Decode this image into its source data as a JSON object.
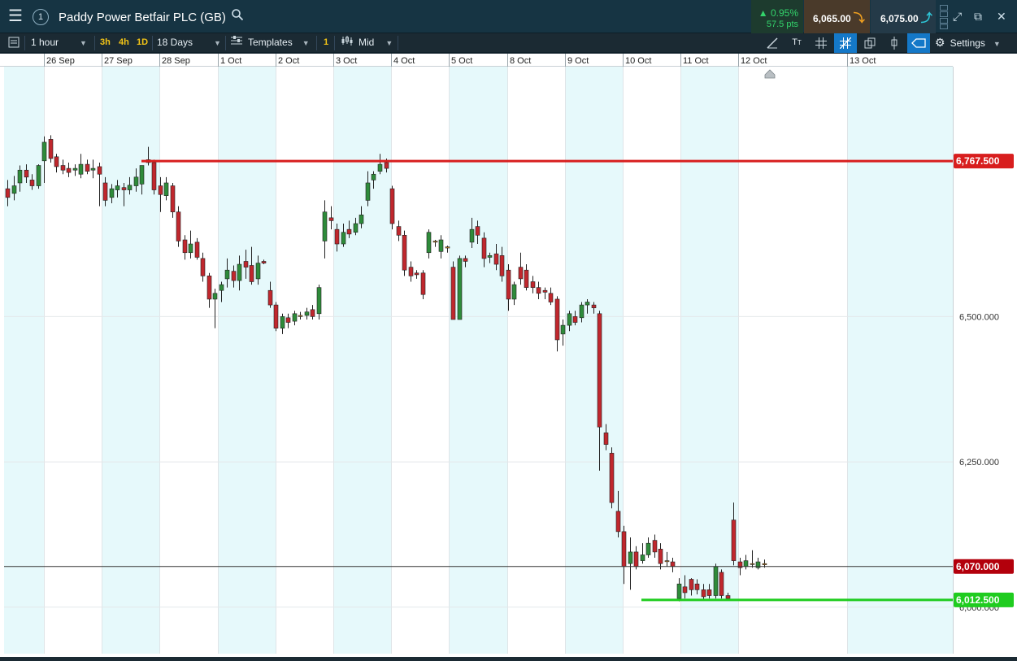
{
  "header": {
    "title": "Paddy Power Betfair PLC (GB)",
    "window_number": "1",
    "change_pct": "0.95%",
    "change_pts": "57.5 pts",
    "sell_price": "6,065.00",
    "buy_price": "6,075.00"
  },
  "toolbar": {
    "interval": "1 hour",
    "quick_intervals": [
      "3h",
      "4h",
      "1D"
    ],
    "range": "18 Days",
    "templates": "Templates",
    "templates_badge": "1",
    "price_type": "Mid",
    "settings": "Settings"
  },
  "colors": {
    "up": "#2e8b3a",
    "down": "#c0272d",
    "resistance": "#d81e1e",
    "support": "#1fcc1f",
    "current": "#b3000c",
    "band": "#e6f9fb"
  },
  "chart_data": {
    "type": "candlestick",
    "ylim": [
      5920,
      6930
    ],
    "y_ticks": [
      "6,500.000",
      "6,250.000",
      "6,000.000"
    ],
    "y_tick_values": [
      6500,
      6250,
      6000
    ],
    "x_labels": [
      "26 Sep",
      "27 Sep",
      "28 Sep",
      "1 Oct",
      "2 Oct",
      "3 Oct",
      "4 Oct",
      "5 Oct",
      "8 Oct",
      "9 Oct",
      "10 Oct",
      "11 Oct",
      "12 Oct",
      "13 Oct"
    ],
    "levels": {
      "resistance": {
        "value": 6767.5,
        "label": "6,767.500"
      },
      "support": {
        "value": 6012.5,
        "label": "6,012.500"
      },
      "current": {
        "value": 6070.0,
        "label": "6,070.000"
      }
    },
    "candles": [
      [
        6720,
        6705,
        6735,
        6690
      ],
      [
        6712,
        6725,
        6742,
        6700
      ],
      [
        6730,
        6752,
        6760,
        6715
      ],
      [
        6752,
        6740,
        6762,
        6730
      ],
      [
        6735,
        6725,
        6745,
        6718
      ],
      [
        6725,
        6760,
        6762,
        6720
      ],
      [
        6768,
        6800,
        6810,
        6730
      ],
      [
        6805,
        6772,
        6812,
        6765
      ],
      [
        6775,
        6758,
        6780,
        6748
      ],
      [
        6760,
        6752,
        6770,
        6745
      ],
      [
        6755,
        6748,
        6765,
        6740
      ],
      [
        6752,
        6755,
        6762,
        6742
      ],
      [
        6745,
        6762,
        6780,
        6738
      ],
      [
        6762,
        6750,
        6770,
        6745
      ],
      [
        6752,
        6755,
        6770,
        6738
      ],
      [
        6758,
        6745,
        6765,
        6690
      ],
      [
        6730,
        6700,
        6740,
        6690
      ],
      [
        6705,
        6720,
        6728,
        6695
      ],
      [
        6718,
        6725,
        6735,
        6705
      ],
      [
        6722,
        6718,
        6730,
        6690
      ],
      [
        6718,
        6726,
        6740,
        6710
      ],
      [
        6725,
        6740,
        6755,
        6715
      ],
      [
        6728,
        6760,
        6760,
        6710
      ],
      [
        6770,
        6765,
        6792,
        6760
      ],
      [
        6765,
        6718,
        6770,
        6710
      ],
      [
        6725,
        6710,
        6740,
        6680
      ],
      [
        6708,
        6730,
        6740,
        6700
      ],
      [
        6725,
        6680,
        6730,
        6670
      ],
      [
        6680,
        6630,
        6690,
        6620
      ],
      [
        6632,
        6610,
        6640,
        6598
      ],
      [
        6610,
        6625,
        6648,
        6600
      ],
      [
        6628,
        6602,
        6635,
        6598
      ],
      [
        6600,
        6570,
        6610,
        6560
      ],
      [
        6570,
        6530,
        6575,
        6515
      ],
      [
        6530,
        6540,
        6548,
        6480
      ],
      [
        6545,
        6555,
        6560,
        6525
      ],
      [
        6565,
        6580,
        6600,
        6550
      ],
      [
        6578,
        6562,
        6588,
        6550
      ],
      [
        6562,
        6590,
        6605,
        6545
      ],
      [
        6595,
        6585,
        6615,
        6565
      ],
      [
        6588,
        6560,
        6620,
        6555
      ],
      [
        6565,
        6592,
        6605,
        6555
      ],
      [
        6595,
        6592,
        6598,
        6590
      ],
      [
        6545,
        6520,
        6560,
        6515
      ],
      [
        6520,
        6480,
        6525,
        6475
      ],
      [
        6480,
        6500,
        6505,
        6470
      ],
      [
        6498,
        6490,
        6505,
        6480
      ],
      [
        6492,
        6505,
        6510,
        6485
      ],
      [
        6500,
        6502,
        6508,
        6495
      ],
      [
        6502,
        6508,
        6515,
        6495
      ],
      [
        6512,
        6500,
        6520,
        6495
      ],
      [
        6505,
        6550,
        6555,
        6495
      ],
      [
        6630,
        6680,
        6700,
        6600
      ],
      [
        6670,
        6665,
        6690,
        6650
      ],
      [
        6650,
        6625,
        6660,
        6612
      ],
      [
        6625,
        6645,
        6660,
        6620
      ],
      [
        6650,
        6642,
        6665,
        6635
      ],
      [
        6645,
        6660,
        6670,
        6640
      ],
      [
        6660,
        6675,
        6690,
        6652
      ],
      [
        6700,
        6730,
        6750,
        6690
      ],
      [
        6735,
        6745,
        6750,
        6720
      ],
      [
        6750,
        6762,
        6780,
        6745
      ],
      [
        6765,
        6755,
        6772,
        6748
      ],
      [
        6720,
        6660,
        6725,
        6650
      ],
      [
        6655,
        6640,
        6665,
        6630
      ],
      [
        6640,
        6580,
        6648,
        6570
      ],
      [
        6585,
        6570,
        6595,
        6560
      ],
      [
        6575,
        6572,
        6580,
        6565
      ],
      [
        6575,
        6538,
        6580,
        6530
      ],
      [
        6610,
        6645,
        6650,
        6600
      ],
      [
        6630,
        6628,
        6632,
        6620
      ],
      [
        6612,
        6632,
        6640,
        6600
      ],
      [
        6620,
        6618,
        6622,
        6610
      ],
      [
        6585,
        6495,
        6595,
        6495
      ],
      [
        6495,
        6600,
        6605,
        6495
      ],
      [
        6600,
        6595,
        6605,
        6585
      ],
      [
        6628,
        6650,
        6670,
        6618
      ],
      [
        6655,
        6640,
        6665,
        6625
      ],
      [
        6635,
        6600,
        6645,
        6585
      ],
      [
        6602,
        6605,
        6610,
        6592
      ],
      [
        6608,
        6590,
        6625,
        6580
      ],
      [
        6605,
        6570,
        6620,
        6560
      ],
      [
        6580,
        6530,
        6590,
        6510
      ],
      [
        6530,
        6555,
        6560,
        6520
      ],
      [
        6585,
        6565,
        6610,
        6555
      ],
      [
        6580,
        6550,
        6590,
        6545
      ],
      [
        6560,
        6550,
        6570,
        6540
      ],
      [
        6550,
        6540,
        6560,
        6530
      ],
      [
        6545,
        6542,
        6550,
        6530
      ],
      [
        6540,
        6525,
        6550,
        6520
      ],
      [
        6530,
        6460,
        6535,
        6440
      ],
      [
        6470,
        6485,
        6495,
        6450
      ],
      [
        6485,
        6505,
        6510,
        6475
      ],
      [
        6500,
        6490,
        6510,
        6485
      ],
      [
        6498,
        6520,
        6525,
        6490
      ],
      [
        6520,
        6525,
        6530,
        6505
      ],
      [
        6520,
        6515,
        6525,
        6505
      ],
      [
        6505,
        6310,
        6510,
        6235
      ],
      [
        6300,
        6280,
        6315,
        6270
      ],
      [
        6265,
        6180,
        6275,
        6170
      ],
      [
        6165,
        6130,
        6200,
        6120
      ],
      [
        6130,
        6070,
        6140,
        6040
      ],
      [
        6075,
        6095,
        6120,
        6030
      ],
      [
        6095,
        6070,
        6105,
        6065
      ],
      [
        6080,
        6090,
        6110,
        6075
      ],
      [
        6090,
        6110,
        6120,
        6085
      ],
      [
        6115,
        6095,
        6125,
        6085
      ],
      [
        6100,
        6075,
        6110,
        6065
      ],
      [
        6080,
        6080,
        6095,
        6070
      ],
      [
        6078,
        6070,
        6085,
        6060
      ],
      [
        6015,
        6040,
        6050,
        6010
      ],
      [
        6035,
        6025,
        6055,
        6015
      ],
      [
        6048,
        6030,
        6050,
        6020
      ],
      [
        6040,
        6030,
        6048,
        6022
      ],
      [
        6030,
        6018,
        6040,
        6012
      ],
      [
        6030,
        6020,
        6040,
        6015
      ],
      [
        6020,
        6070,
        6075,
        6015
      ],
      [
        6060,
        6020,
        6065,
        6015
      ],
      [
        6020,
        6015,
        6025,
        6012
      ],
      [
        6150,
        6080,
        6180,
        6072
      ],
      [
        6078,
        6068,
        6085,
        6055
      ],
      [
        6070,
        6080,
        6090,
        6065
      ],
      [
        6075,
        6075,
        6098,
        6068
      ],
      [
        6068,
        6078,
        6085,
        6065
      ],
      [
        6075,
        6073,
        6082,
        6068
      ]
    ]
  }
}
